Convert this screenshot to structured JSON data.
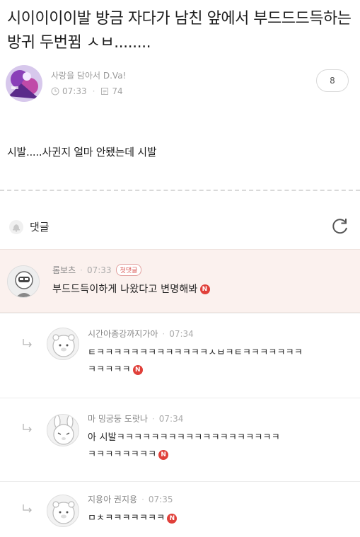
{
  "post": {
    "title": "시이이이이발 방금 자다가 남친 앞에서 부드드드득하는 방귀 두번뀜 ㅅㅂ........",
    "author": "사랑을 담아서 D.Va!",
    "time": "07:33",
    "views": "74",
    "comment_count": "8",
    "body": "시발.....사귄지 얼마 안됐는데 시발"
  },
  "comments_section": {
    "label": "댓글",
    "new_badge": "N",
    "comments": [
      {
        "author": "롬보츠",
        "time": "07:33",
        "badge": "첫댓글",
        "text": "부드드득이하게 나왔다고 변명해봐"
      },
      {
        "author": "시간아종강까지가아",
        "time": "07:34",
        "line1": "ㅌㅋㅋㅋㅋㅋㅋㅋㅋㅋㅋㅋㅋㅋㅅㅂㅋㅌㅋㅋㅋㅋㅋㅋㅋ",
        "line2": "ㅋㅋㅋㅋㅋ"
      },
      {
        "author": "마 밍궁둥 도랏나",
        "time": "07:34",
        "line1": "아 시발ㅋㅋㅋㅋㅋㅋㅋㅋㅋㅋㅋㅋㅋㅋㅋㅋㅋㅋㅋ",
        "line2": "ㅋㅋㅋㅋㅋㅋㅋㅋ"
      },
      {
        "author": "지용아 권지용",
        "time": "07:35",
        "text": "ㅁㅊㅋㅋㅋㅋㅋㅋㅋ"
      }
    ]
  },
  "colors": {
    "highlight_bg": "#fbf1ee",
    "new_badge": "#e0403a",
    "first_badge": "#d9534f"
  }
}
